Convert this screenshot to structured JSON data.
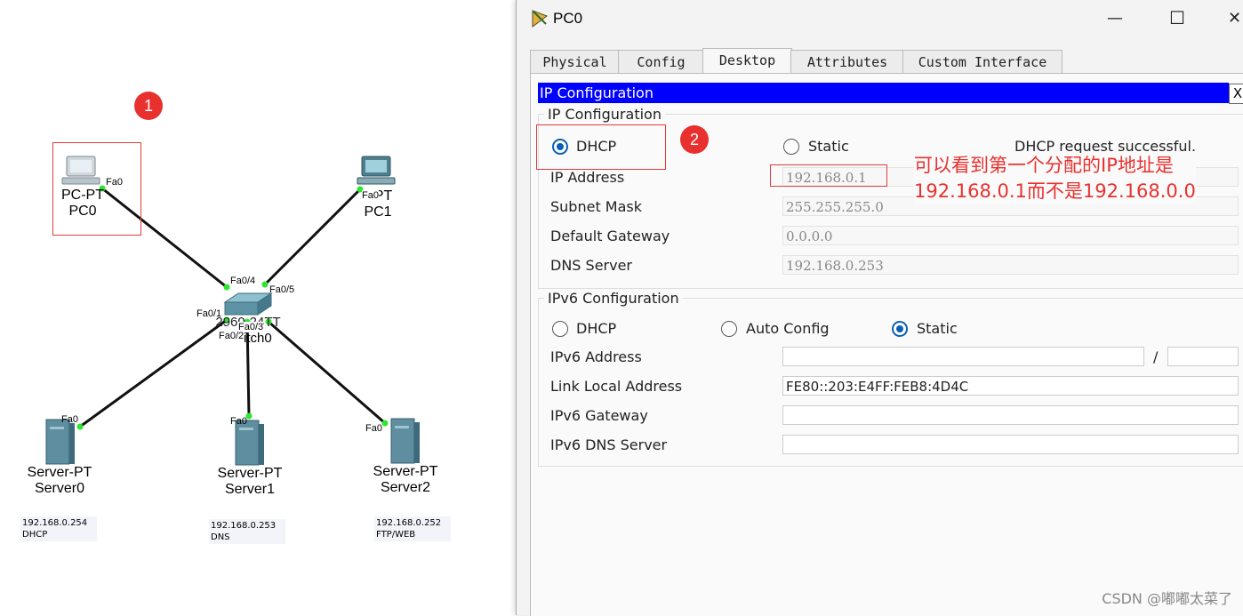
{
  "topology": {
    "pc0": {
      "model": "PC-PT",
      "name": "PC0",
      "port": "Fa0"
    },
    "pc1": {
      "model": "PT",
      "name": "PC1",
      "port": "Fa0"
    },
    "switch": {
      "model": "2960-24TT",
      "model_visible": "2960-24TT",
      "name": "Switch0",
      "name_visible": "itch0",
      "ports": {
        "p1": "Fa0/1",
        "p2": "Fa0/2",
        "p3": "Fa0/3",
        "p4": "Fa0/4",
        "p5": "Fa0/5"
      }
    },
    "server0": {
      "model": "Server-PT",
      "name": "Server0",
      "port": "Fa0",
      "note_ip": "192.168.0.254",
      "note_role": "DHCP"
    },
    "server1": {
      "model": "Server-PT",
      "name": "Server1",
      "port": "Fa0",
      "note_ip": "192.168.0.253",
      "note_role": "DNS"
    },
    "server2": {
      "model": "Server-PT",
      "name": "Server2",
      "port": "Fa0",
      "note_ip": "192.168.0.252",
      "note_role": "FTP/WEB"
    },
    "badge1": "1"
  },
  "window": {
    "title": "PC0",
    "minimize": "—",
    "maximize": "☐",
    "close": "✕",
    "tabs": [
      "Physical",
      "Config",
      "Desktop",
      "Attributes",
      "Custom Interface"
    ],
    "active_tab": "Desktop",
    "app_bar_title": "IP Configuration",
    "app_close": "X",
    "ipv4": {
      "group_title": "IP Configuration",
      "dhcp_label": "DHCP",
      "static_label": "Static",
      "mode": "DHCP",
      "status": "DHCP request successful.",
      "ip_label": "IP Address",
      "ip_value": "192.168.0.1",
      "mask_label": "Subnet Mask",
      "mask_value": "255.255.255.0",
      "gw_label": "Default Gateway",
      "gw_value": "0.0.0.0",
      "dns_label": "DNS Server",
      "dns_value": "192.168.0.253"
    },
    "ipv6": {
      "group_title": "IPv6 Configuration",
      "dhcp_label": "DHCP",
      "auto_label": "Auto Config",
      "static_label": "Static",
      "mode": "Static",
      "addr_label": "IPv6 Address",
      "addr_value": "",
      "prefix_sep": "/",
      "prefix_value": "",
      "link_label": "Link Local Address",
      "link_value": "FE80::203:E4FF:FEB8:4D4C",
      "gw_label": "IPv6 Gateway",
      "gw_value": "",
      "dns_label": "IPv6 DNS Server",
      "dns_value": ""
    }
  },
  "annotation": {
    "badge2": "2",
    "line1": "可以看到第一个分配的IP地址是",
    "line2": "192.168.0.1而不是192.168.0.0",
    "color": "#e8312f"
  },
  "watermark": "CSDN @嘟嘟太菜了"
}
